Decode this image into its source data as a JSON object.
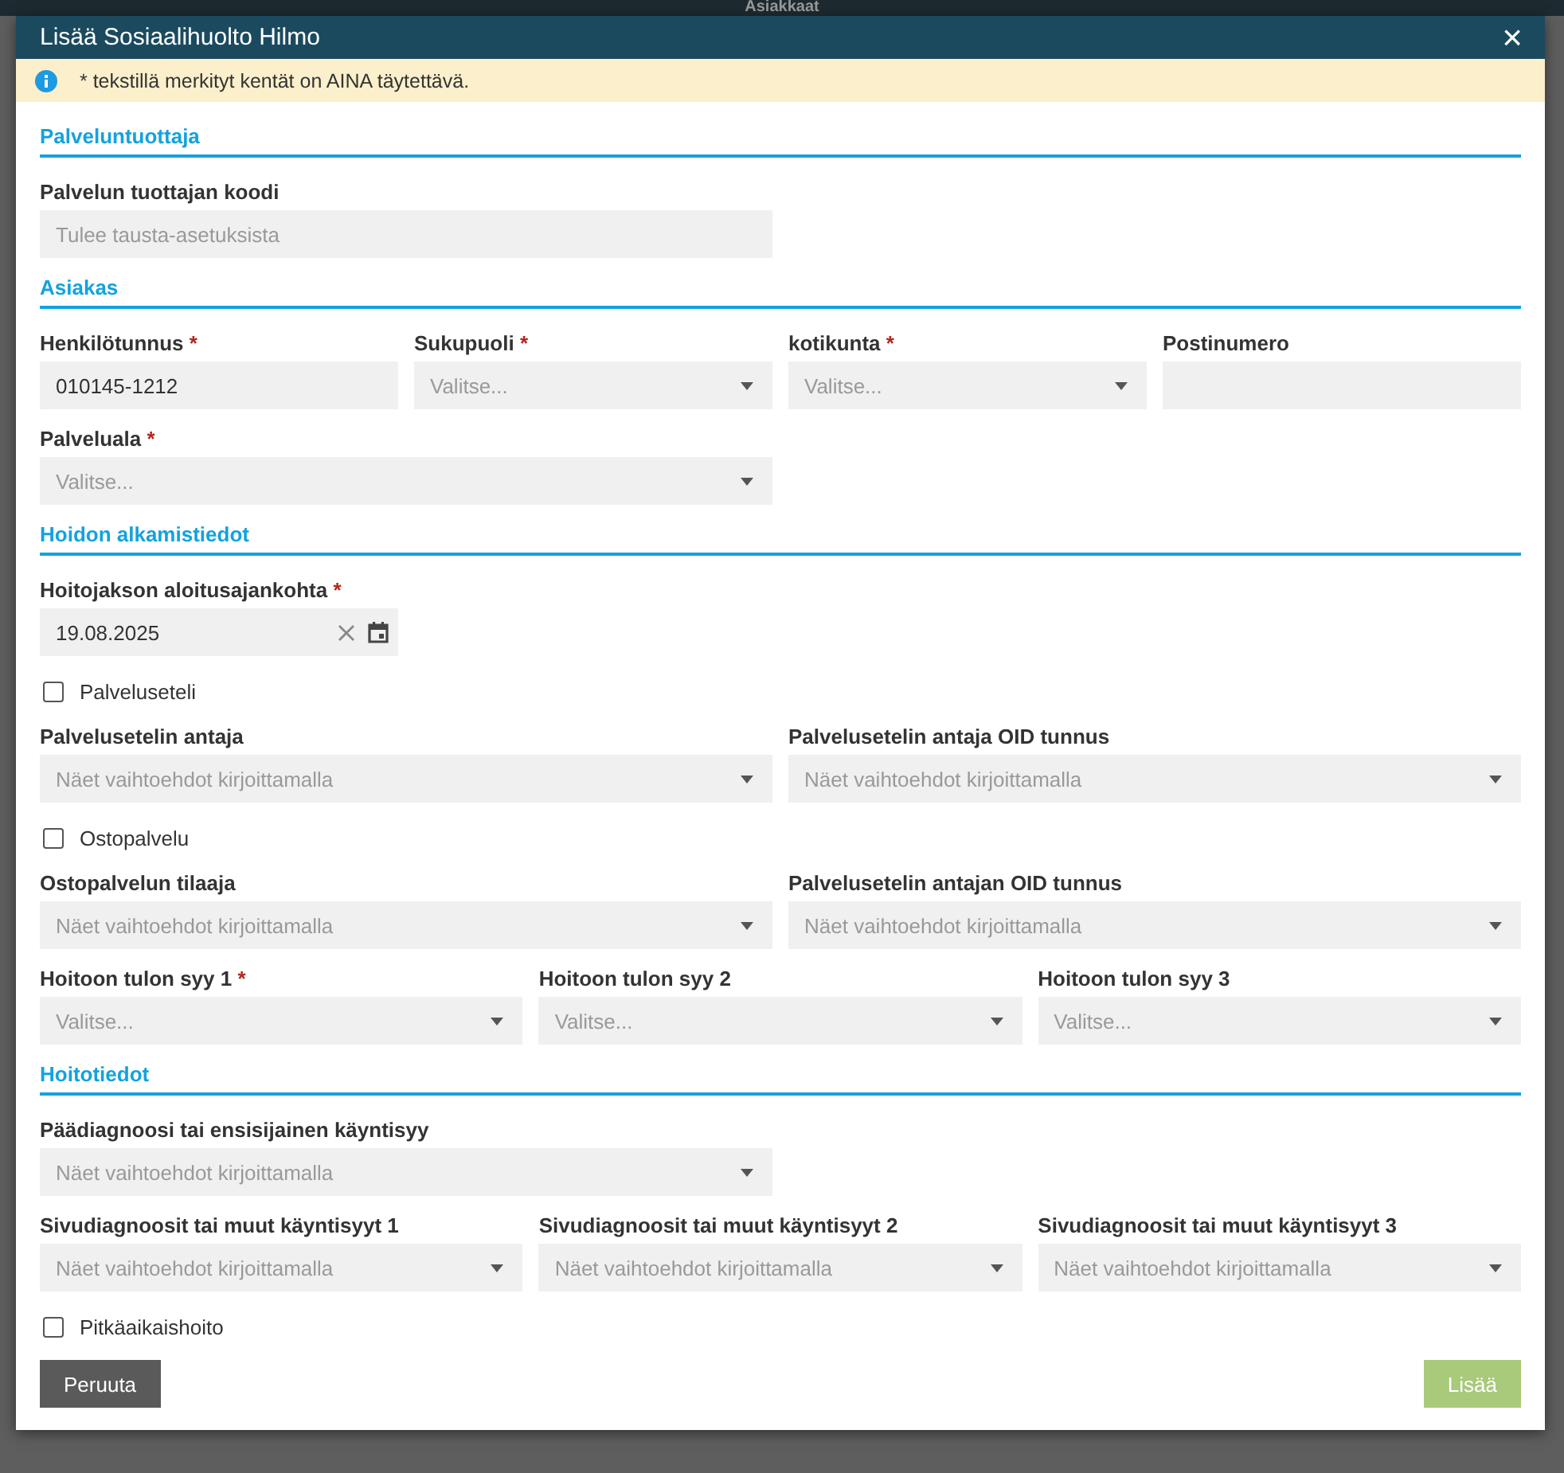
{
  "background": {
    "title": "Asiakkaat"
  },
  "dialog": {
    "title": "Lisää Sosiaalihuolto Hilmo",
    "close": "×"
  },
  "notice": {
    "text": "* tekstillä merkityt kentät on AINA täytettävä."
  },
  "sections": [
    {
      "title": "Palveluntuottaja",
      "rows": [
        {
          "fields": [
            {
              "kind": "text",
              "label": "Palvelun tuottajan koodi",
              "required": false,
              "placeholder": "Tulee tausta-asetuksista"
            }
          ]
        }
      ]
    },
    {
      "title": "Asiakas",
      "rows": [
        {
          "fields": [
            {
              "kind": "text",
              "label": "Henkilötunnus",
              "required": true,
              "value": "010145-1212"
            },
            {
              "kind": "select",
              "label": "Sukupuoli",
              "required": true,
              "placeholder": "Valitse..."
            },
            {
              "kind": "select",
              "label": "kotikunta",
              "required": true,
              "placeholder": "Valitse..."
            },
            {
              "kind": "text",
              "label": "Postinumero",
              "required": false
            }
          ]
        },
        {
          "fields": [
            {
              "kind": "select",
              "label": "Palveluala",
              "required": true,
              "placeholder": "Valitse..."
            }
          ]
        }
      ]
    },
    {
      "title": "Hoidon alkamistiedot",
      "rows": [
        {
          "fields": [
            {
              "kind": "date",
              "label": "Hoitojakson aloitusajankohta",
              "required": true,
              "value": "19.08.2025"
            }
          ]
        },
        {
          "fields": [
            {
              "kind": "checkbox",
              "label": "Palveluseteli",
              "checked": false
            }
          ]
        },
        {
          "fields": [
            {
              "kind": "select",
              "label": "Palvelusetelin antaja",
              "required": false,
              "placeholder": "Näet vaihtoehdot kirjoittamalla"
            },
            {
              "kind": "select",
              "label": "Palvelusetelin antaja OID tunnus",
              "required": false,
              "placeholder": "Näet vaihtoehdot kirjoittamalla"
            }
          ]
        },
        {
          "fields": [
            {
              "kind": "checkbox",
              "label": "Ostopalvelu",
              "checked": false
            }
          ]
        },
        {
          "fields": [
            {
              "kind": "select",
              "label": "Ostopalvelun tilaaja",
              "required": false,
              "placeholder": "Näet vaihtoehdot kirjoittamalla"
            },
            {
              "kind": "select",
              "label": "Palvelusetelin antajan OID tunnus",
              "required": false,
              "placeholder": "Näet vaihtoehdot kirjoittamalla"
            }
          ]
        },
        {
          "fields": [
            {
              "kind": "select",
              "label": "Hoitoon tulon syy 1",
              "required": true,
              "placeholder": "Valitse..."
            },
            {
              "kind": "select",
              "label": "Hoitoon tulon syy 2",
              "required": false,
              "placeholder": "Valitse..."
            },
            {
              "kind": "select",
              "label": "Hoitoon tulon syy 3",
              "required": false,
              "placeholder": "Valitse..."
            }
          ]
        }
      ]
    },
    {
      "title": "Hoitotiedot",
      "rows": [
        {
          "fields": [
            {
              "kind": "select",
              "label": "Päädiagnoosi tai ensisijainen käyntisyy",
              "required": false,
              "placeholder": "Näet vaihtoehdot kirjoittamalla"
            }
          ]
        },
        {
          "fields": [
            {
              "kind": "select",
              "label": "Sivudiagnoosit tai muut käyntisyyt 1",
              "required": false,
              "placeholder": "Näet vaihtoehdot kirjoittamalla"
            },
            {
              "kind": "select",
              "label": "Sivudiagnoosit tai muut käyntisyyt 2",
              "required": false,
              "placeholder": "Näet vaihtoehdot kirjoittamalla"
            },
            {
              "kind": "select",
              "label": "Sivudiagnoosit tai muut käyntisyyt 3",
              "required": false,
              "placeholder": "Näet vaihtoehdot kirjoittamalla"
            }
          ]
        },
        {
          "fields": [
            {
              "kind": "checkbox",
              "label": "Pitkäaikaishoito",
              "checked": false
            }
          ]
        }
      ]
    }
  ],
  "required_mark": "*",
  "buttons": [
    {
      "kind": "cancel",
      "label": "Peruuta"
    },
    {
      "kind": "submit",
      "label": "Lisää"
    }
  ]
}
